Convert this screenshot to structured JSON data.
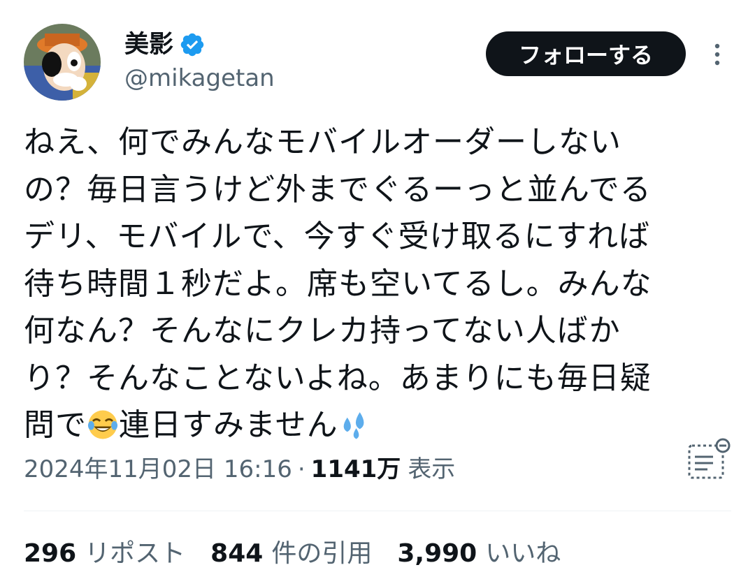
{
  "author": {
    "display_name": "美影",
    "handle": "@mikagetan",
    "verified": true,
    "verified_color": "#1d9bf0"
  },
  "actions": {
    "follow_label": "フォローする",
    "more_icon": "more-dots-icon"
  },
  "tweet": {
    "lines": [
      "ねえ、何でみんなモバイルオーダーしない",
      "の？毎日言うけど外までぐるーっと並んでる",
      "デリ、モバイルで、今すぐ受け取るにすれば",
      "待ち時間１秒だよ。席も空いてるし。みんな",
      "何なん？そんなにクレカ持ってない人ばか",
      "り？そんなことないよね。あまりにも毎日疑"
    ],
    "last_line_part1": "問で",
    "emoji_1": "face-with-tears-of-joy-icon",
    "last_line_part2": "連日すみません",
    "emoji_2": "sweat-droplets-icon"
  },
  "meta": {
    "timestamp": "2024年11月02日 16:16",
    "separator": "·",
    "views_count": "1141万",
    "views_label": "表示",
    "analytics_icon": "post-analytics-icon"
  },
  "stats": {
    "reposts_count": "296",
    "reposts_label": "リポスト",
    "quotes_count": "844",
    "quotes_label": "件の引用",
    "likes_count": "3,990",
    "likes_label": "いいね"
  },
  "colors": {
    "text_primary": "#0f1419",
    "text_secondary": "#536471",
    "follow_bg": "#0f1419",
    "divider": "#eff3f4"
  }
}
